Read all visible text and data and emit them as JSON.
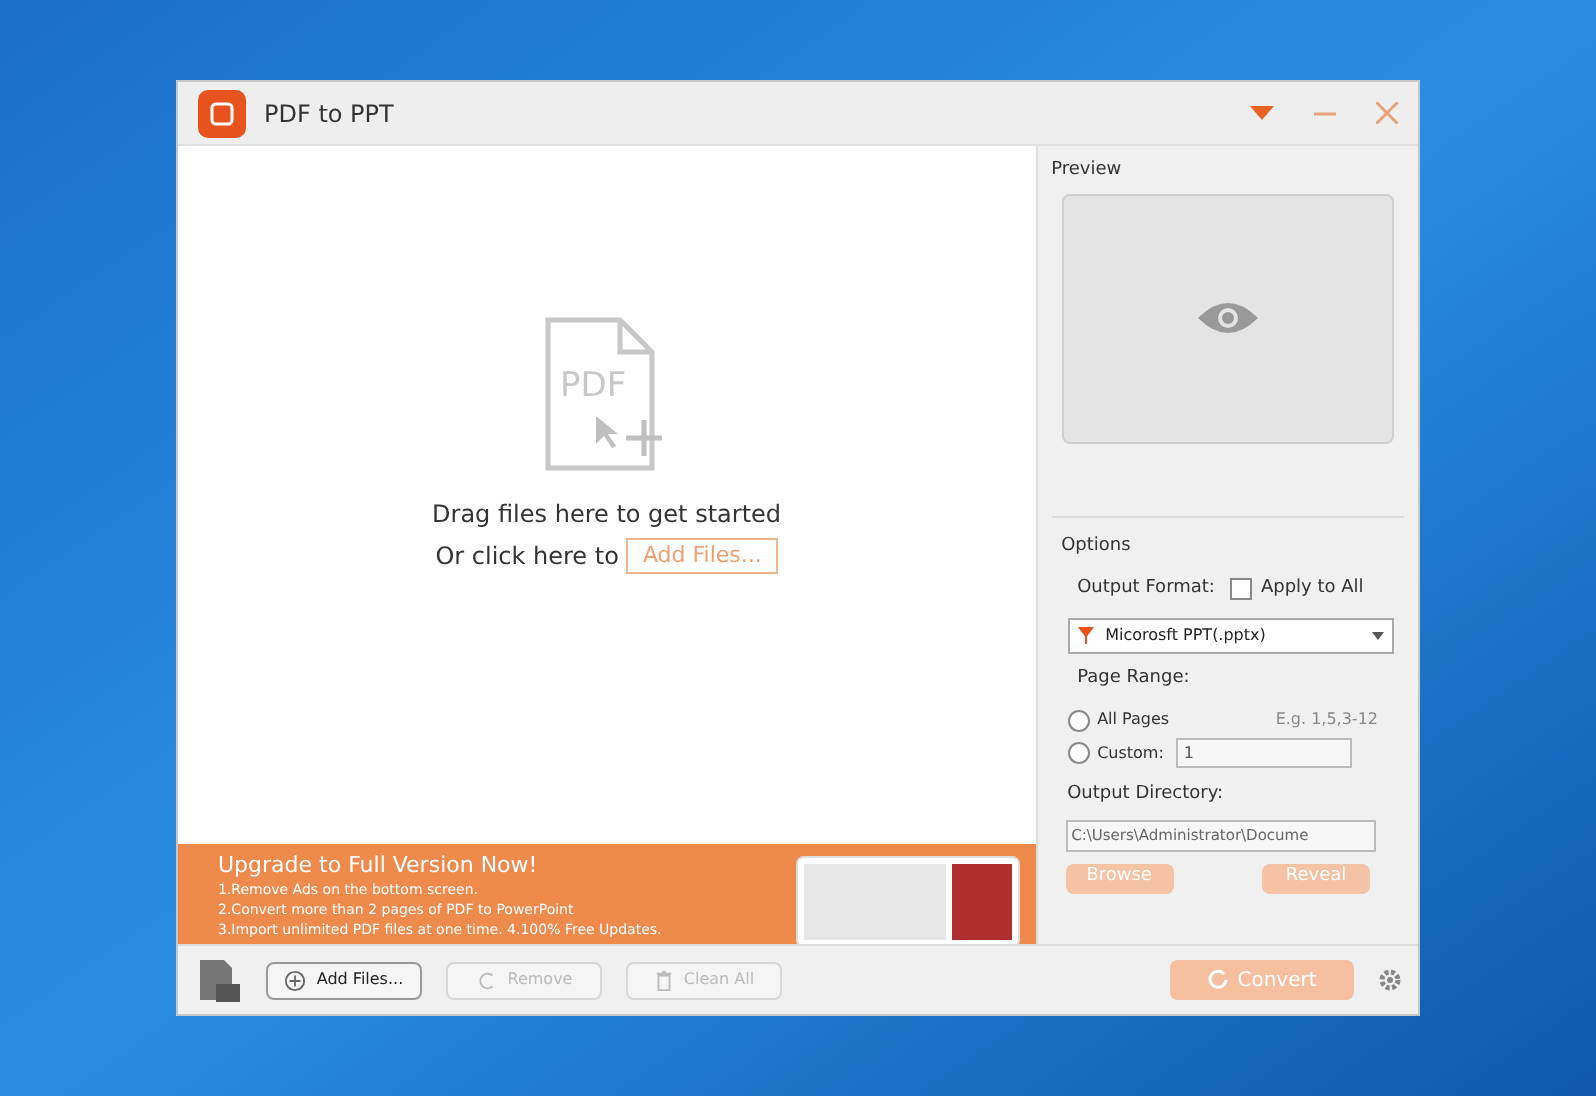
{
  "window": {
    "title": "PDF to PPT"
  },
  "drop_zone": {
    "icon_label": "PDF",
    "line_1": "Drag files here to get started",
    "line_2": "Or click here to",
    "add_button": "Add Files..."
  },
  "banner": {
    "title": "Upgrade to Full Version Now!",
    "lines": [
      "1.Remove Ads on the bottom screen.",
      "2.Convert more than 2 pages of PDF to PowerPoint",
      "3.Import unlimited PDF files at one time. 4.100% Free Updates."
    ]
  },
  "preview": {
    "label": "Preview"
  },
  "options": {
    "label": "Options",
    "output_format_label": "Output Format:",
    "apply_to_all": {
      "label": "Apply to All",
      "checked": false
    },
    "format": "Micorosft PPT(.pptx)",
    "page_range_label": "Page Range:",
    "hint": "E.g. 1,5,3-12",
    "radios": [
      {
        "label": "All Pages",
        "selected": false
      },
      {
        "label": "Custom:",
        "selected": false
      }
    ],
    "custom_value": "1",
    "output_directory_label": "Output Directory:",
    "directory": "C:\\Users\\Administrator\\Docume",
    "browse": {
      "label": "Browse",
      "disabled": true
    },
    "reveal": {
      "label": "Reveal",
      "disabled": true
    }
  },
  "toolbar": [
    {
      "label": "Add Files...",
      "disabled": false
    },
    {
      "label": "Remove",
      "disabled": true
    },
    {
      "label": "Clean All",
      "disabled": true
    }
  ],
  "convert": {
    "label": "Convert",
    "disabled": true
  }
}
